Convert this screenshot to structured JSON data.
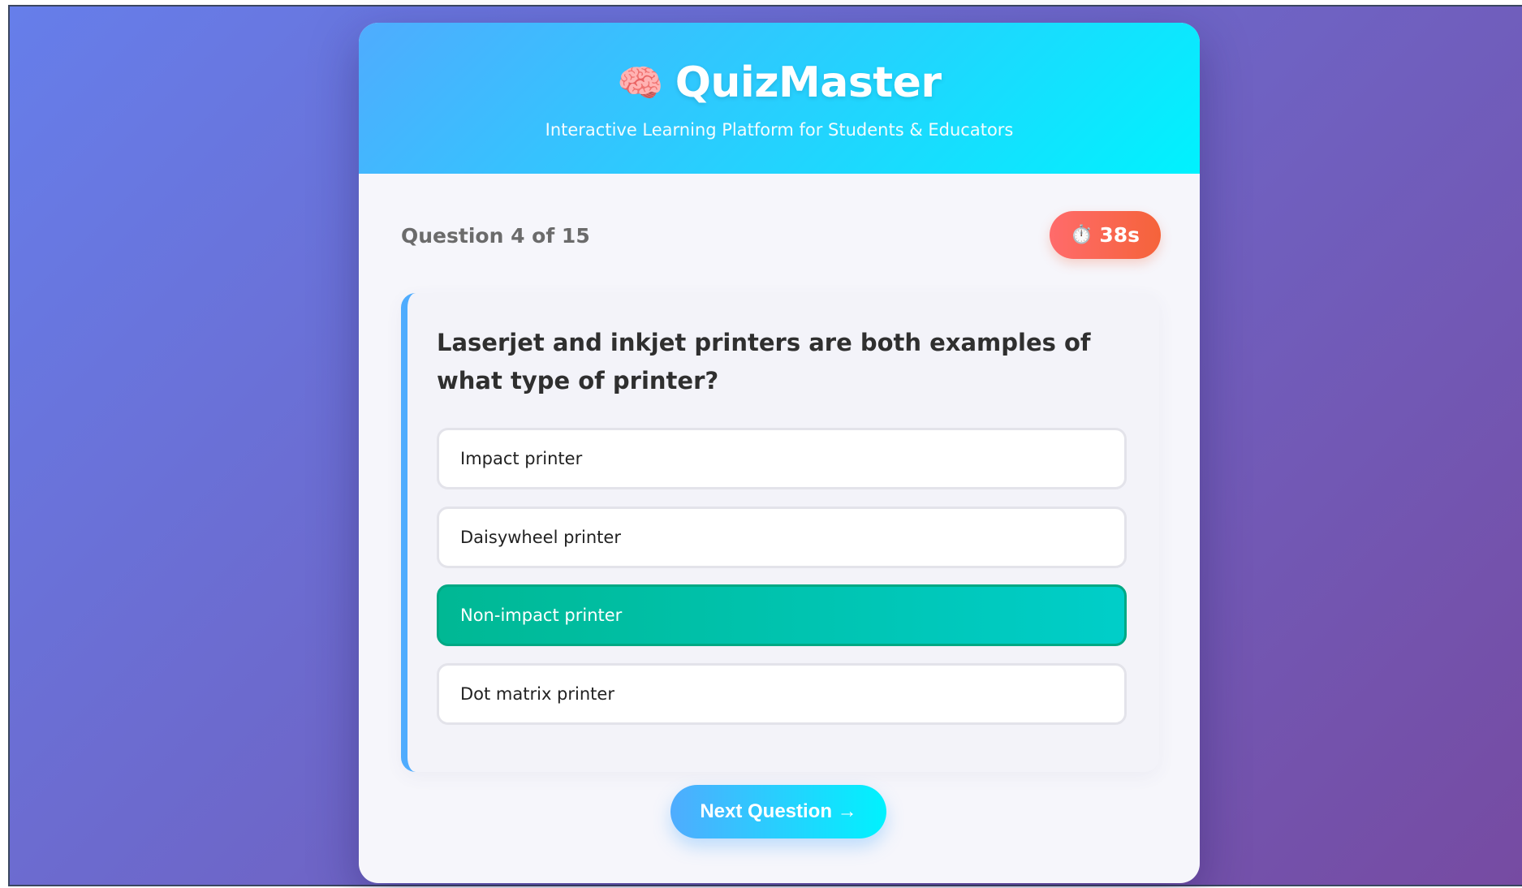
{
  "app": {
    "title": "QuizMaster",
    "subtitle": "Interactive Learning Platform for Students & Educators",
    "logo_icon": "brain-icon",
    "logo_glyph": "🧠"
  },
  "quiz": {
    "counter": "Question 4 of 15",
    "timer": {
      "icon": "stopwatch-icon",
      "glyph": "⏱️",
      "value": "38s"
    },
    "question": "Laserjet and inkjet printers are both examples of what type of printer?",
    "options": [
      {
        "label": "Impact printer",
        "selected": false
      },
      {
        "label": "Daisywheel printer",
        "selected": false
      },
      {
        "label": "Non-impact printer",
        "selected": true
      },
      {
        "label": "Dot matrix printer",
        "selected": false
      }
    ],
    "next_button": "Next Question →"
  },
  "colors": {
    "background_start": "#667eea",
    "background_end": "#764ba2",
    "header_start": "#4facfe",
    "header_end": "#00f2fe",
    "timer": "#f5633a",
    "selected_option": "#00b894"
  }
}
